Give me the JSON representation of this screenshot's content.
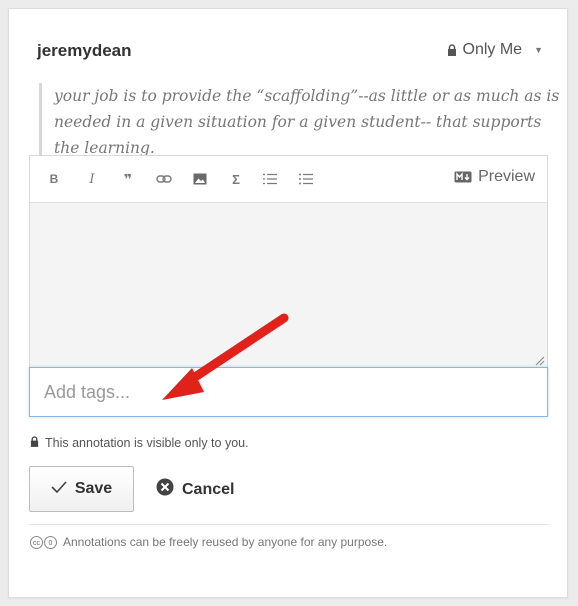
{
  "annotation": {
    "username": "jeremydean",
    "privacy_label": "Only Me",
    "quote": "your job is to provide the “scaffolding”--as little or as much as is needed in a given situation for a given student-- that supports the learning."
  },
  "toolbar": {
    "bold": "B",
    "italic": "I",
    "quote": "❞",
    "link": "⊖",
    "math": "Σ",
    "preview_label": "Preview"
  },
  "editor": {
    "body_value": ""
  },
  "tags": {
    "placeholder": "Add tags..."
  },
  "visibility_note": "This annotation is visible only to you.",
  "actions": {
    "save_label": "Save",
    "cancel_label": "Cancel"
  },
  "license_note": "Annotations can be freely reused by anyone for any purpose.",
  "colors": {
    "arrow": "#e0221b",
    "tags_border": "#8ab6e0",
    "text": "#333333",
    "quote": "#777777"
  }
}
